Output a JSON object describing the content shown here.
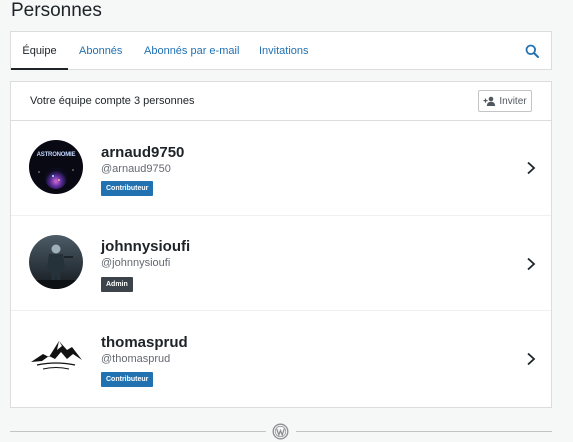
{
  "page": {
    "title": "Personnes"
  },
  "tabs": [
    {
      "label": "Équipe",
      "active": true
    },
    {
      "label": "Abonnés",
      "active": false
    },
    {
      "label": "Abonnés par e-mail",
      "active": false
    },
    {
      "label": "Invitations",
      "active": false
    }
  ],
  "search": {
    "icon": "search-icon"
  },
  "team": {
    "count_text": "Votre équipe compte 3 personnes",
    "invite_label": "Inviter"
  },
  "members": [
    {
      "name": "arnaud9750",
      "handle": "@arnaud9750",
      "role": "Contributeur",
      "avatar_text": "ASTRONOMIE"
    },
    {
      "name": "johnnysioufi",
      "handle": "@johnnysioufi",
      "role": "Admin"
    },
    {
      "name": "thomasprud",
      "handle": "@thomasprud",
      "role": "Contributeur"
    }
  ],
  "colors": {
    "accent": "#2271b1",
    "admin_badge": "#3c434a",
    "background": "#f6f7f7"
  }
}
